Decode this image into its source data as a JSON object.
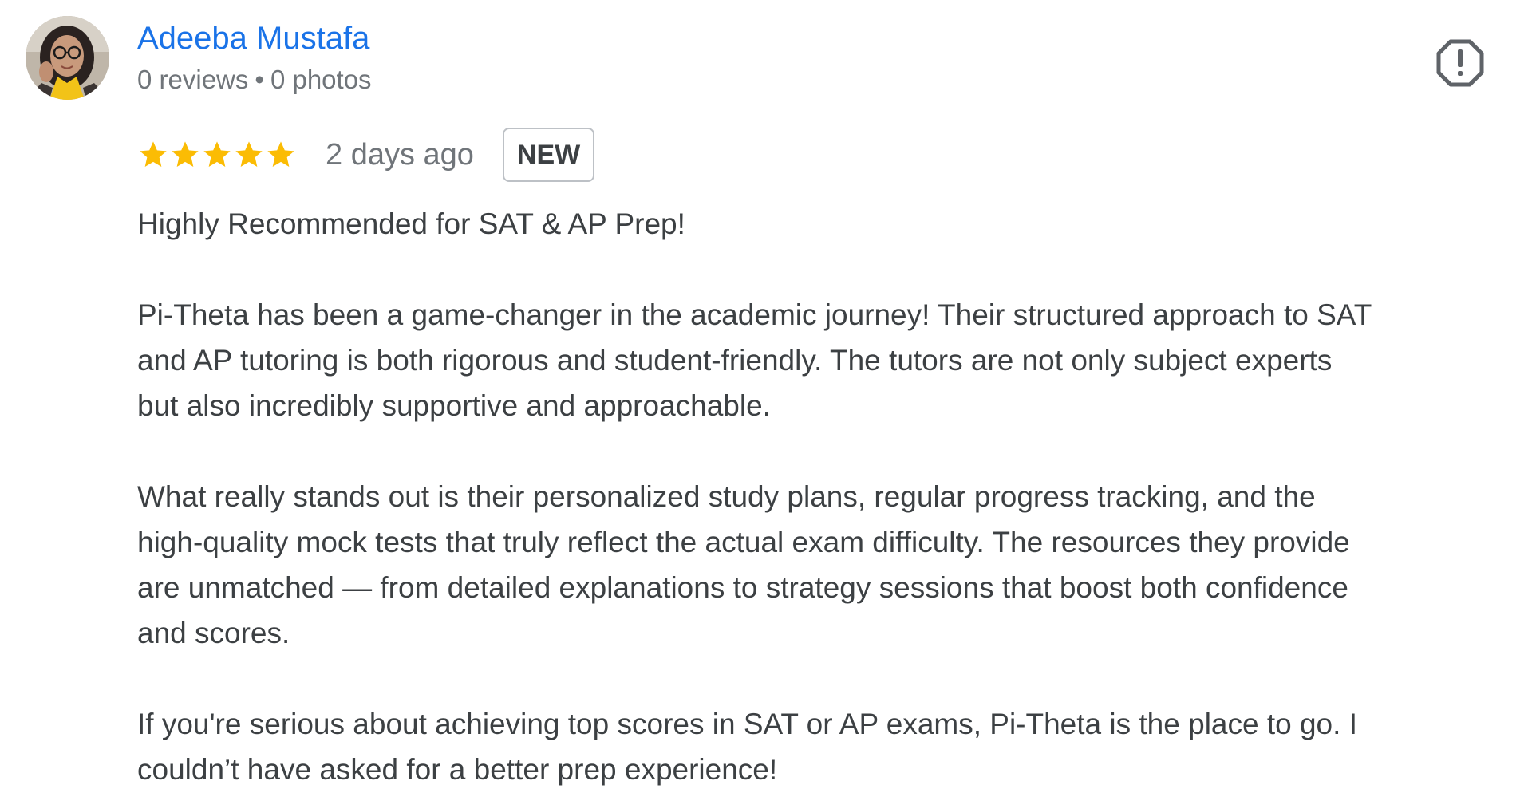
{
  "review": {
    "author": {
      "name": "Adeeba Mustafa",
      "reviews_count": "0 reviews",
      "separator": "•",
      "photos_count": "0 photos"
    },
    "rating": {
      "stars": 5,
      "max_stars": 5,
      "star_color": "#fbbc04"
    },
    "date": "2 days ago",
    "badge": "NEW",
    "paragraphs": [
      "Highly Recommended for SAT & AP Prep!",
      "Pi-Theta has been a game-changer in the academic journey! Their structured approach to SAT\nand AP tutoring is both rigorous and student-friendly. The tutors are not only subject experts\nbut also incredibly supportive and approachable.",
      "What really stands out is their personalized study plans, regular progress tracking, and the\nhigh-quality mock tests that truly reflect the actual exam difficulty. The resources they provide\nare unmatched — from detailed explanations to strategy sessions that boost both confidence\nand scores.",
      "If you're serious about achieving top scores in SAT or AP exams, Pi-Theta is the place to go. I\ncouldn’t have asked for a better prep experience!"
    ]
  },
  "icons": {
    "report": "report-flag-icon",
    "star": "star-icon",
    "avatar": "user-avatar"
  },
  "colors": {
    "author_link": "#1a73e8",
    "meta_text": "#70757a",
    "body_text": "#3c4043",
    "badge_border": "#bdc1c6"
  }
}
